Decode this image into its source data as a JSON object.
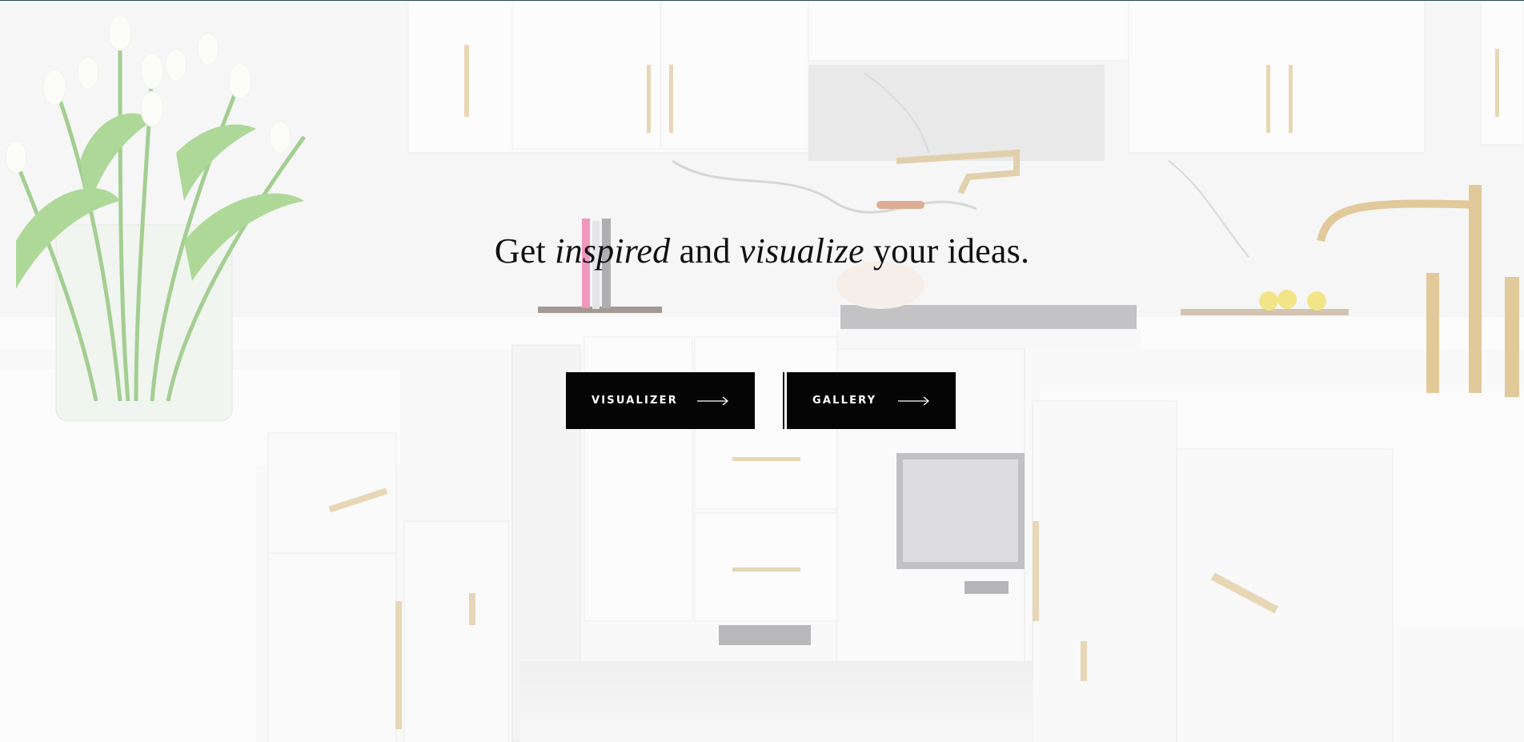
{
  "hero": {
    "headline": {
      "part1": "Get ",
      "em1": "inspired",
      "part2": " and ",
      "em2": "visualize",
      "part3": " your ideas."
    },
    "buttons": {
      "visualizer_label": "VISUALIZER",
      "gallery_label": "GALLERY"
    },
    "arrow_icon": "arrow-right-icon"
  },
  "colors": {
    "button_bg": "#050505",
    "button_text": "#ffffff",
    "headline_text": "#111111",
    "brass": "#c9a45c"
  }
}
